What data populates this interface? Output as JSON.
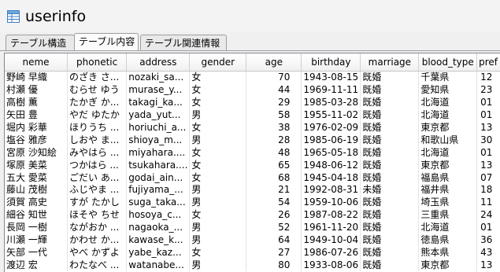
{
  "window": {
    "title": "userinfo",
    "icon": "table-icon"
  },
  "tabs": [
    {
      "label": "テーブル構造",
      "active": false
    },
    {
      "label": "テーブル内容",
      "active": true
    },
    {
      "label": "テーブル関連情報",
      "active": false
    }
  ],
  "table": {
    "columns": [
      "neme",
      "phonetic",
      "address",
      "gender",
      "age",
      "birthday",
      "marriage",
      "blood_type",
      "pref"
    ],
    "rows": [
      [
        "野崎 早織",
        "のざき さ...",
        "nozaki_sa...",
        "女",
        "70",
        "1943-08-15",
        "既婚",
        "千葉県",
        "12"
      ],
      [
        "村瀬 優",
        "むらせ ゆう",
        "murase_y...",
        "女",
        "44",
        "1969-11-11",
        "既婚",
        "愛知県",
        "23"
      ],
      [
        "高樹 薫",
        "たかぎ か...",
        "takagi_ka...",
        "女",
        "29",
        "1985-03-28",
        "既婚",
        "北海道",
        "01"
      ],
      [
        "矢田 豊",
        "やだ ゆたか",
        "yada_yut...",
        "男",
        "58",
        "1955-11-02",
        "既婚",
        "北海道",
        "01"
      ],
      [
        "堀内 彩華",
        "ほりうち ...",
        "horiuchi_a...",
        "女",
        "38",
        "1976-02-09",
        "既婚",
        "東京都",
        "13"
      ],
      [
        "塩谷 雅彦",
        "しおや ま...",
        "shioya_m...",
        "男",
        "28",
        "1985-06-19",
        "既婚",
        "和歌山県",
        "30"
      ],
      [
        "宮原 沙知絵",
        "みやはら ...",
        "miyahara....",
        "女",
        "48",
        "1965-05-18",
        "既婚",
        "北海道",
        "01"
      ],
      [
        "塚原 美菜",
        "つかはら ...",
        "tsukahara....",
        "女",
        "65",
        "1948-06-12",
        "既婚",
        "東京都",
        "13"
      ],
      [
        "五大 愛菜",
        "ごだい あ...",
        "godai_ain...",
        "女",
        "68",
        "1945-04-18",
        "既婚",
        "福島県",
        "07"
      ],
      [
        "藤山 茂樹",
        "ふじやま ...",
        "fujiyama_...",
        "男",
        "21",
        "1992-08-31",
        "未婚",
        "福井県",
        "18"
      ],
      [
        "須賀 高史",
        "すが たかし",
        "suga_taka...",
        "男",
        "54",
        "1959-10-06",
        "既婚",
        "埼玉県",
        "11"
      ],
      [
        "細谷 知世",
        "ほそや ちせ",
        "hosoya_c...",
        "女",
        "26",
        "1987-08-22",
        "既婚",
        "三重県",
        "24"
      ],
      [
        "長岡 一樹",
        "ながおか ...",
        "nagaoka_...",
        "男",
        "52",
        "1961-11-20",
        "既婚",
        "北海道",
        "01"
      ],
      [
        "川瀬 一輝",
        "かわせ か...",
        "kawase_k...",
        "男",
        "64",
        "1949-10-04",
        "既婚",
        "徳島県",
        "36"
      ],
      [
        "矢部 一代",
        "やべ かずよ",
        "yabe_kaz...",
        "女",
        "27",
        "1986-07-26",
        "既婚",
        "熊本県",
        "43"
      ],
      [
        "渡辺 宏",
        "わたなべ ...",
        "watanabe...",
        "男",
        "80",
        "1933-08-06",
        "既婚",
        "東京都",
        "13"
      ]
    ]
  },
  "colors": {
    "grid_background": "#ffffff",
    "header_background": "#f5f5f5",
    "window_background": "#f0f0f0"
  }
}
